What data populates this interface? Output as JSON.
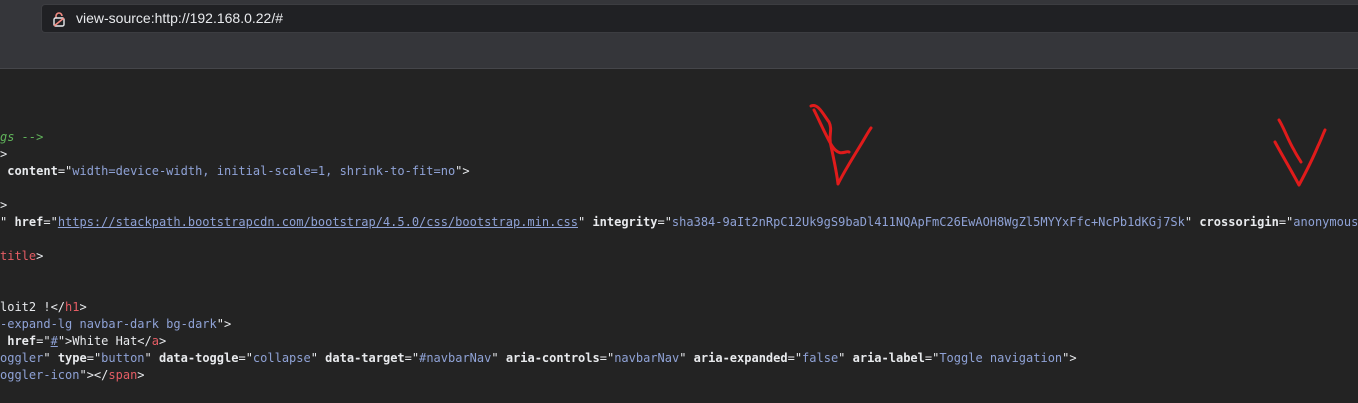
{
  "browser": {
    "url": "view-source:http://192.168.0.22/#"
  },
  "source": {
    "line1": {
      "comment": "gs -->"
    },
    "line2": {
      "punct": ">"
    },
    "line3": {
      "attr": "content",
      "eq": "=\"",
      "val": "width=device-width, initial-scale=1, shrink-to-fit=no",
      "end": "\">"
    },
    "line4": {
      "punct": ">"
    },
    "line5": {
      "lead": "\" ",
      "attr_href": "href",
      "eq1": "=\"",
      "href_val": "https://stackpath.bootstrapcdn.com/bootstrap/4.5.0/css/bootstrap.min.css",
      "q1": "\" ",
      "attr_integrity": "integrity",
      "eq2": "=\"",
      "integrity_val": "sha384-9aIt2nRpC12Uk9gS9baDl411NQApFmC26EwAOH8WgZl5MYYxFfc+NcPb1dKGj7Sk",
      "q2": "\" ",
      "attr_crossorigin": "crossorigin",
      "eq3": "=\"",
      "crossorigin_val": "anonymous",
      "q3": "\""
    },
    "line6": {
      "tag": "title",
      "end": ">"
    },
    "line7": {
      "text": "loit2 !</",
      "tag": "h1",
      "end": ">"
    },
    "line8": {
      "val": "-expand-lg navbar-dark bg-dark",
      "end": "\">"
    },
    "line9": {
      "attr": "href",
      "eq": "=\"",
      "val": "#",
      "mid": "\">White Hat</",
      "tag": "a",
      "end": ">"
    },
    "line10": {
      "val": "oggler",
      "q0": "\" ",
      "attr_type": "type",
      "type_val": "button",
      "attr_toggle": "data-toggle",
      "toggle_val": "collapse",
      "attr_target": "data-target",
      "target_val": "#navbarNav",
      "attr_controls": "aria-controls",
      "controls_val": "navbarNav",
      "attr_expanded": "aria-expanded",
      "expanded_val": "false",
      "attr_label": "aria-label",
      "label_val": "Toggle navigation",
      "eq": "=\"",
      "sep": "\" ",
      "end": "\">"
    },
    "line11": {
      "val": "oggler-icon",
      "mid": "\"></",
      "tag": "span",
      "end": ">"
    }
  },
  "colors": {
    "chrome": "#35363a",
    "omnibox": "#202124",
    "source_bg": "#232323",
    "tag": "#e55d64",
    "attr_value": "#8fa2d6",
    "comment": "#60b35a",
    "annotation_red": "#e01b1b"
  },
  "icons": {
    "omnibox_icon": "insecure-lock-icon"
  }
}
